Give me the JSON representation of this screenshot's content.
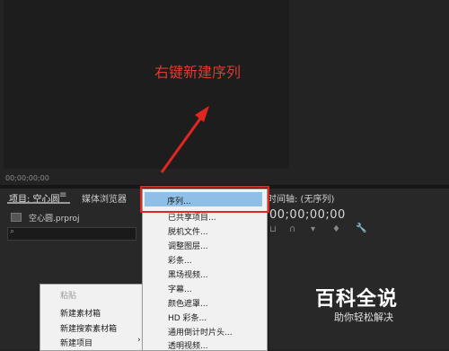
{
  "monitor": {
    "timecode": "00;00;00;00"
  },
  "annotation": {
    "callout": "右键新建序列",
    "arrow_color": "#e0261f"
  },
  "project_panel": {
    "tab_label": "项目: 空心圆",
    "menu_icon": "≡",
    "media_browser_tab": "媒体浏览器",
    "file_name": "空心圆.prproj",
    "search_placeholder": ""
  },
  "timeline_panel": {
    "tab_label": "时间轴: (无序列)",
    "menu_icon": "≡",
    "timecode": "00;00;00;00",
    "wrench_icon": "wrench-icon"
  },
  "context_menu": {
    "items": [
      {
        "label": "粘贴",
        "enabled": false
      },
      {
        "label": "新建素材箱",
        "enabled": true
      },
      {
        "label": "新建搜索素材箱",
        "enabled": true
      },
      {
        "label": "新建项目",
        "enabled": true,
        "submenu_arrow": "›"
      }
    ]
  },
  "submenu": {
    "items": [
      {
        "label": "序列...",
        "highlighted": true
      },
      {
        "label": "已共享项目...",
        "highlighted": false
      },
      {
        "label": "脱机文件...",
        "highlighted": false
      },
      {
        "label": "调整图层...",
        "highlighted": false
      },
      {
        "label": "彩条...",
        "highlighted": false
      },
      {
        "label": "黑场视频...",
        "highlighted": false
      },
      {
        "label": "字幕...",
        "highlighted": false
      },
      {
        "label": "颜色遮罩...",
        "highlighted": false
      },
      {
        "label": "HD 彩条...",
        "highlighted": false
      },
      {
        "label": "通用倒计时片头...",
        "highlighted": false
      },
      {
        "label": "透明视频...",
        "highlighted": false
      }
    ]
  },
  "watermark": {
    "title": "百科全说",
    "subtitle": "助你轻松解决"
  }
}
